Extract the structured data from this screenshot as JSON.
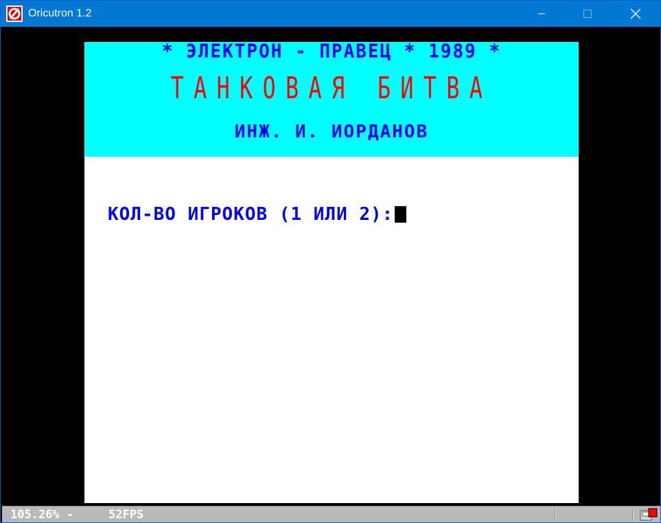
{
  "window": {
    "title": "Oricutron 1.2",
    "titlebar_color": "#0078d4",
    "icons": {
      "app": "oricutron-logo-icon",
      "minimize": "minimize-icon",
      "maximize": "maximize-icon",
      "close": "close-icon"
    }
  },
  "screen": {
    "header": {
      "credit_line": "* ЭЛЕКТРОН - ПРАВЕЦ * 1989 *",
      "title_line": "ТАНКОВАЯ БИТВА",
      "author_line": "ИНЖ. И. ИОРДАНОВ"
    },
    "prompt": "КОЛ-ВО ИГРОКОВ (1 ИЛИ 2):",
    "colors": {
      "header_background": "#00ffff",
      "screen_background": "#ffffff",
      "border": "#000000",
      "blue_text": "#0000ff",
      "red_text": "#ff0000",
      "cursor": "#000000"
    }
  },
  "statusbar": {
    "zoom": "105.26% -",
    "fps": "52FPS",
    "indicator_icon": "disk-activity-icon",
    "indicator_color": "#ff0000"
  }
}
